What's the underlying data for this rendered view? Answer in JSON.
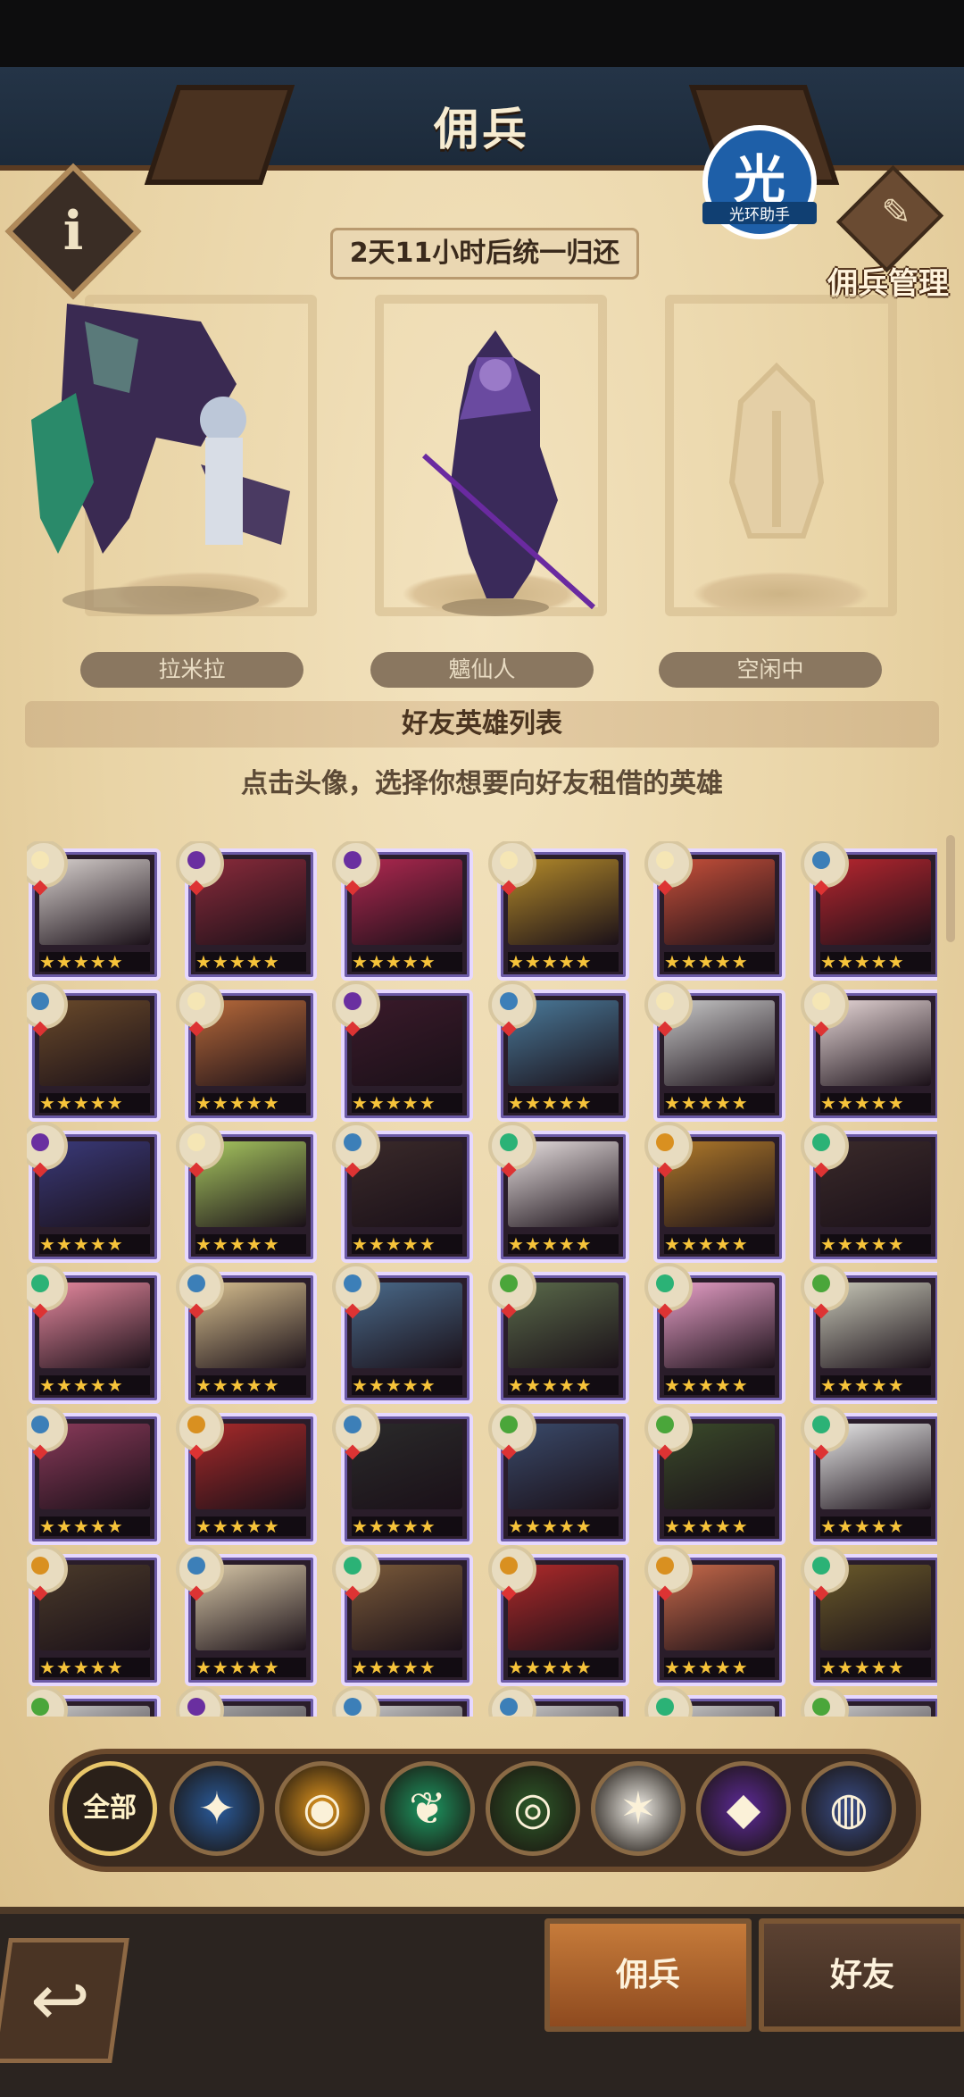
{
  "header": {
    "title": "佣兵",
    "manage_label": "佣兵管理",
    "watermark_glyph": "光",
    "watermark_text": "光环助手"
  },
  "timer": "2天11小时后统一归还",
  "slots": [
    {
      "name": "拉米拉",
      "state": "occupied"
    },
    {
      "name": "魑仙人",
      "state": "occupied"
    },
    {
      "name": "空闲中",
      "state": "empty"
    }
  ],
  "friends_section": {
    "title": "好友英雄列表",
    "hint": "点击头像，选择你想要向好友租借的英雄"
  },
  "hero_cards": {
    "stars_text": "★★★★★",
    "rows": [
      [
        "#d9d2cf",
        "#8b2b3b",
        "#b02850",
        "#b38a2a",
        "#c8503a",
        "#b8262f"
      ],
      [
        "#6a4a2a",
        "#b86a3a",
        "#3a1a2a",
        "#4a7a9a",
        "#c8c8c8",
        "#e8d8d8"
      ],
      [
        "#3a3a7a",
        "#a8c860",
        "#3a2a2a",
        "#e8e0e0",
        "#b07a2a",
        "#3a2a2a"
      ],
      [
        "#e88aa0",
        "#d8c090",
        "#4a6a8a",
        "#5a6a4a",
        "#e8a0c8",
        "#c8c8b8"
      ],
      [
        "#8a3a5a",
        "#a82a2a",
        "#2a2a2a",
        "#3a4a6a",
        "#3a4a2a",
        "#e8e8e8"
      ],
      [
        "#4a3a2a",
        "#d8c8a8",
        "#7a5a3a",
        "#b02a2a",
        "#c86a4a",
        "#6a5a2a"
      ],
      [
        "#c8c8c8",
        "#a8a8a8",
        "#c8c8c8",
        "#c8c8c8",
        "#c8c8c8",
        "#c8c8c8"
      ]
    ],
    "emblems": [
      [
        "light",
        "shadow",
        "shadow",
        "light",
        "light",
        "blue"
      ],
      [
        "blue",
        "light",
        "shadow",
        "blue",
        "light",
        "light"
      ],
      [
        "shadow",
        "light",
        "blue",
        "green",
        "orange",
        "green"
      ],
      [
        "green",
        "blue",
        "blue",
        "yellowgreen",
        "green",
        "yellowgreen"
      ],
      [
        "blue",
        "orange",
        "blue",
        "yellowgreen",
        "yellowgreen",
        "green"
      ],
      [
        "orange",
        "blue",
        "green",
        "orange",
        "orange",
        "green"
      ],
      [
        "yellowgreen",
        "shadow",
        "blue",
        "blue",
        "green",
        "yellowgreen"
      ]
    ],
    "emblem_colors": {
      "light": "#f5e6b5",
      "shadow": "#6a2fa0",
      "blue": "#3c7fb8",
      "green": "#2bb276",
      "yellowgreen": "#4aa63a",
      "orange": "#d99020"
    }
  },
  "filters": [
    {
      "label": "全部",
      "icon": "all"
    },
    {
      "label": "",
      "icon": "lightbearer-icon",
      "color": "#2a5b9c",
      "glyph": "✦"
    },
    {
      "label": "",
      "icon": "mauler-icon",
      "color": "#e79a1f",
      "glyph": "◉"
    },
    {
      "label": "",
      "icon": "wilder-icon",
      "color": "#1d9a63",
      "glyph": "❦"
    },
    {
      "label": "",
      "icon": "graveborn-icon",
      "color": "#2e5a2a",
      "glyph": "◎"
    },
    {
      "label": "",
      "icon": "celestial-icon",
      "color": "#f2efe8",
      "glyph": "✶"
    },
    {
      "label": "",
      "icon": "hypogean-icon",
      "color": "#5e2a9a",
      "glyph": "◆"
    },
    {
      "label": "",
      "icon": "dimensional-icon",
      "color": "#3a4e8a",
      "glyph": "◍"
    }
  ],
  "tabs": {
    "mercenary": "佣兵",
    "friends": "好友"
  },
  "back_glyph": "↩"
}
